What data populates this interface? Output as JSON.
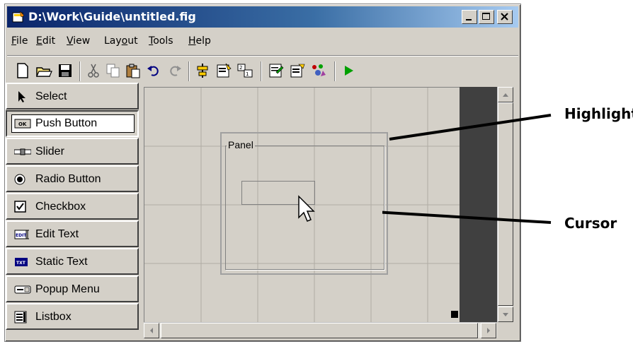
{
  "window": {
    "title": "D:\\Work\\Guide\\untitled.fig"
  },
  "menu": [
    {
      "underline": "F",
      "rest": "ile"
    },
    {
      "underline": "E",
      "rest": "dit"
    },
    {
      "underline": "V",
      "rest": "iew"
    },
    {
      "prefix": "Lay",
      "underline": "o",
      "rest": "ut"
    },
    {
      "underline": "T",
      "rest": "ools"
    },
    {
      "underline": "H",
      "rest": "elp"
    }
  ],
  "toolbar_icons": [
    "new-icon",
    "open-icon",
    "save-icon",
    "cut-icon",
    "copy-icon",
    "paste-icon",
    "undo-icon",
    "redo-icon",
    "align-icon",
    "menu-editor-icon",
    "tab-order-icon",
    "mfile-editor-icon",
    "property-inspector-icon",
    "object-browser-icon",
    "run-icon"
  ],
  "palette": [
    {
      "label": "Select",
      "icon": "arrow-icon"
    },
    {
      "label": "Push Button",
      "icon": "push-button-icon"
    },
    {
      "label": "Slider",
      "icon": "slider-icon"
    },
    {
      "label": "Radio Button",
      "icon": "radio-button-icon"
    },
    {
      "label": "Checkbox",
      "icon": "checkbox-icon"
    },
    {
      "label": "Edit Text",
      "icon": "edit-text-icon"
    },
    {
      "label": "Static Text",
      "icon": "static-text-icon"
    },
    {
      "label": "Popup Menu",
      "icon": "popup-menu-icon"
    },
    {
      "label": "Listbox",
      "icon": "listbox-icon"
    }
  ],
  "icon_text": {
    "push_button": "OK",
    "edit_text": "EDIT",
    "static_text": "TXT"
  },
  "layout": {
    "panel_label": "Panel"
  },
  "callouts": {
    "highlight": "Highlight",
    "cursor": "Cursor"
  },
  "colors": {
    "titlebar_start": "#0a246a",
    "titlebar_end": "#a6caf0",
    "face": "#d4d0c8",
    "run_green": "#00a000"
  }
}
